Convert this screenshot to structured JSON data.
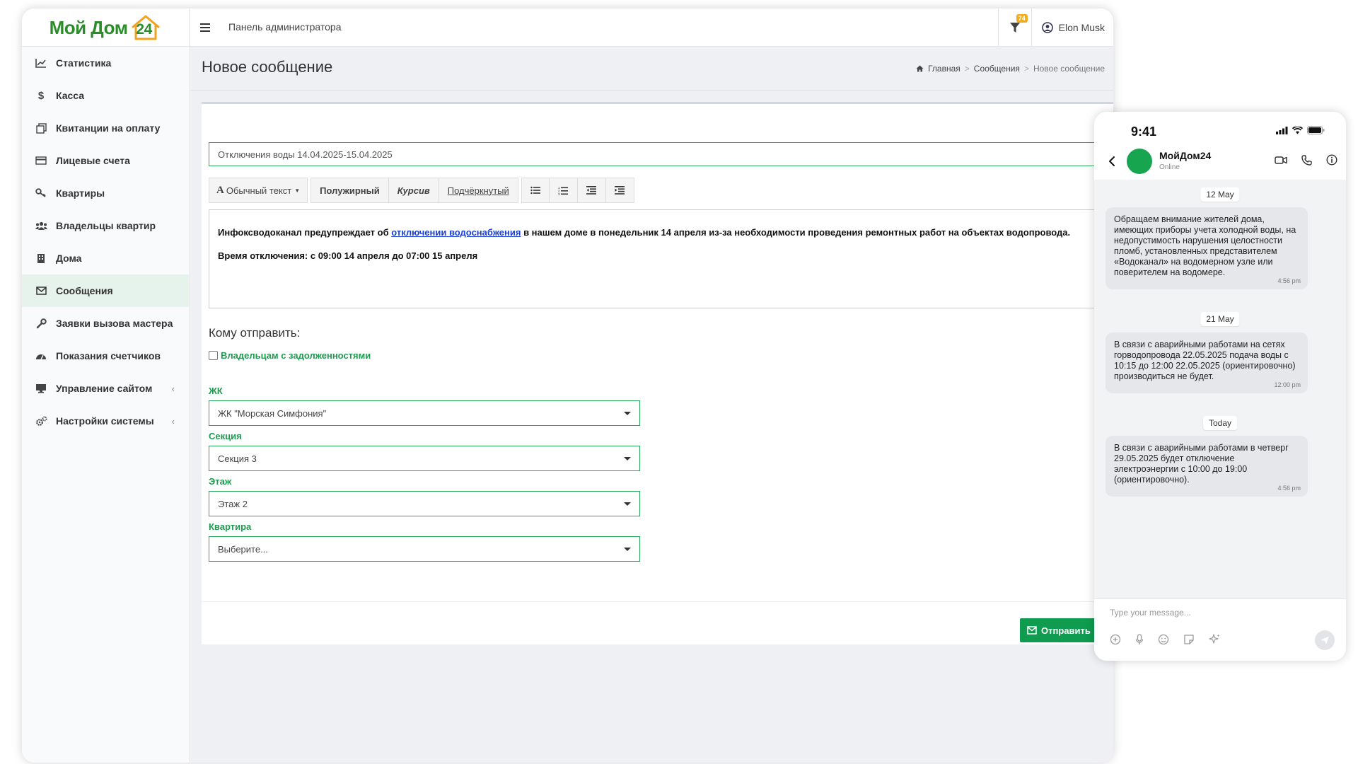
{
  "app": {
    "logo_text": "Мой Дом",
    "logo_number": "24",
    "topbar_title": "Панель администратора",
    "notifications_count": "74",
    "user_name": "Elon Musk"
  },
  "sidebar": {
    "items": [
      {
        "label": "Статистика",
        "icon": "chart-line-icon"
      },
      {
        "label": "Касса",
        "icon": "dollar-icon"
      },
      {
        "label": "Квитанции на оплату",
        "icon": "receipt-icon"
      },
      {
        "label": "Лицевые счета",
        "icon": "credit-card-icon"
      },
      {
        "label": "Квартиры",
        "icon": "key-icon"
      },
      {
        "label": "Владельцы квартир",
        "icon": "users-icon"
      },
      {
        "label": "Дома",
        "icon": "building-icon"
      },
      {
        "label": "Сообщения",
        "icon": "envelope-icon"
      },
      {
        "label": "Заявки вызова мастера",
        "icon": "wrench-icon"
      },
      {
        "label": "Показания счетчиков",
        "icon": "dashboard-icon"
      },
      {
        "label": "Управление сайтом",
        "icon": "desktop-icon"
      },
      {
        "label": "Настройки системы",
        "icon": "cogs-icon"
      }
    ],
    "active_item": "Сообщения"
  },
  "page": {
    "title": "Новое сообщение",
    "breadcrumb": [
      "Главная",
      "Сообщения",
      "Новое сообщение"
    ]
  },
  "form": {
    "subject_value": "Отключения воды 14.04.2025-15.04.2025",
    "toolbar": {
      "style_label": "Обычный текст",
      "bold_label": "Полужирный",
      "italic_label": "Курсив",
      "underline_label": "Подчёркнутый"
    },
    "body": {
      "p1_before": "Инфоксводоканал предупреждает об ",
      "p1_link": "отключении водоснабжения",
      "p1_after": " в нашем доме в понедельник 14 апреля из-за необходимости проведения ремонтных работ на объектах водопровода.",
      "p2": "Время отключения: с 09:00 14 апреля до 07:00 15 апреля"
    },
    "send_to_label": "Кому отправить:",
    "debtors_label": "Владельцам с задолженностями",
    "debtors_checked": false,
    "fields": {
      "complex_label": "ЖК",
      "complex_value": "ЖК \"Морская Симфония\"",
      "section_label": "Секция",
      "section_value": "Секция 3",
      "floor_label": "Этаж",
      "floor_value": "Этаж 2",
      "apartment_label": "Квартира",
      "apartment_placeholder": "Выберите..."
    },
    "send_button": "Отправить"
  },
  "phone": {
    "time": "9:41",
    "chat_name": "МойДом24",
    "chat_status": "Online",
    "messages": [
      {
        "date": "12 May",
        "text": "Обращаем внимание жителей дома, имеющих приборы учета холодной воды, на недопустимость нарушения целостности пломб, установленных представителем «Водоканал» на водомерном узле или поверителем на водомере.",
        "time": "4:56 pm"
      },
      {
        "date": "21 May",
        "text": "В связи с аварийными работами на сетях горводопровода 22.05.2025 подача воды с 10:15 до 12:00 22.05.2025 (ориентировочно) производиться не будет.",
        "time": "12:00 pm"
      },
      {
        "date": "Today",
        "text": "В связи с аварийными работами в четверг 29.05.2025 будет отключение электроэнергии с 10:00 до 19:00 (ориентировочно).",
        "time": "4:56 pm"
      }
    ],
    "input_placeholder": "Type your message..."
  },
  "colors": {
    "brand_green": "#0f9b50",
    "label_green": "#1f9a4f",
    "badge": "#f0ad1e",
    "link_blue": "#1a3fd8"
  }
}
